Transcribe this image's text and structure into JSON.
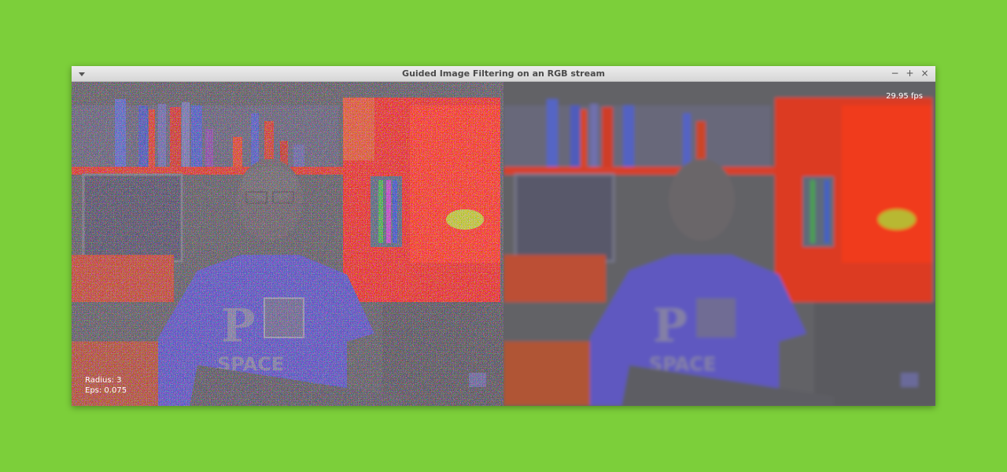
{
  "window": {
    "title": "Guided Image Filtering on an RGB stream",
    "controls": {
      "minimize": "−",
      "maximize": "+",
      "close": "×"
    }
  },
  "overlay": {
    "fps": "29.95 fps",
    "radius_label": "Radius: 3",
    "eps_label": "Eps: 0.075"
  },
  "shirt_text": {
    "letter": "P",
    "word": "SPACE"
  },
  "colors": {
    "desktop": "#7ccf3a",
    "frame_gray": "#626266",
    "hot_red": "#ff2a10",
    "shirt_blue": "#5a55c8"
  }
}
